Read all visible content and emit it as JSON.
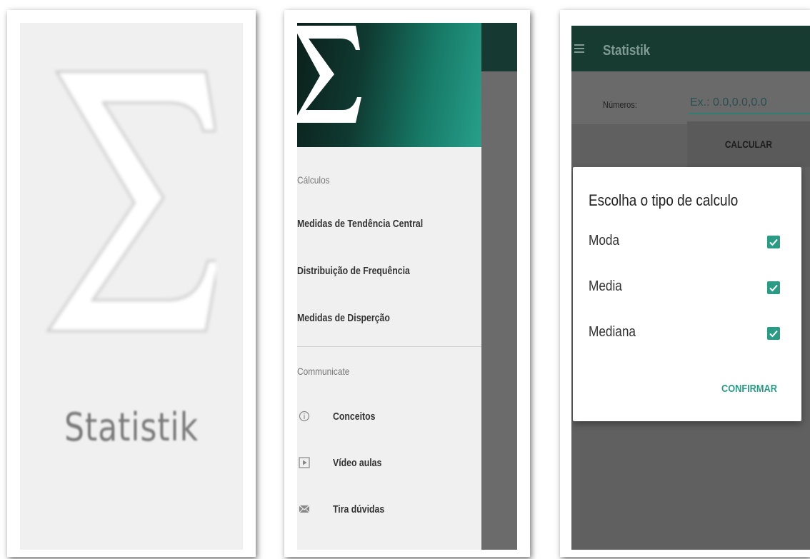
{
  "splash": {
    "logo_icon": "sigma-icon",
    "app_name": "Statistik"
  },
  "drawer": {
    "header_icon": "sigma-icon",
    "sections": [
      {
        "label": "Cálculos",
        "items": [
          "Medidas de Tendência Central",
          "Distribuição de Frequência",
          "Medidas de Disperção"
        ]
      },
      {
        "label": "Communicate",
        "items": [
          {
            "icon": "info-icon",
            "label": "Conceitos"
          },
          {
            "icon": "play-icon",
            "label": "Vídeo aulas"
          },
          {
            "icon": "mail-icon",
            "label": "Tira dúvidas"
          }
        ]
      }
    ]
  },
  "calculator": {
    "app_title": "Statistik",
    "menu_icon": "hamburger-menu-icon",
    "numbers_label": "Números:",
    "numbers_input": {
      "value": "",
      "placeholder": "Ex.: 0.0,0.0,0.0"
    },
    "calculate_label": "CALCULAR",
    "dialog": {
      "title": "Escolha o tipo de calculo",
      "options": [
        {
          "label": "Moda",
          "checked": true
        },
        {
          "label": "Media",
          "checked": true
        },
        {
          "label": "Mediana",
          "checked": true
        }
      ],
      "confirm_label": "CONFIRMAR"
    }
  },
  "colors": {
    "appbar": "#173a31",
    "accent": "#2c9b86",
    "drawer_gradient_start": "#0b1f1a",
    "drawer_gradient_end": "#27a08b",
    "scrim": "#606060"
  }
}
